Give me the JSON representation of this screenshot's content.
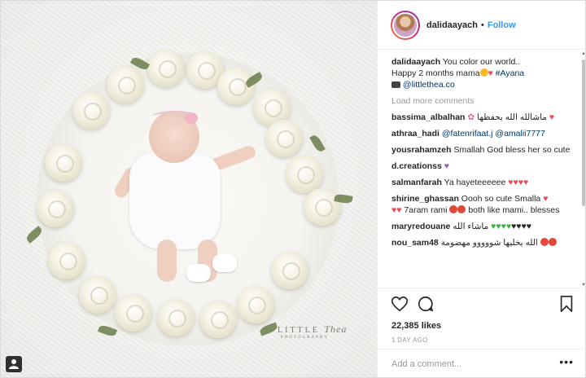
{
  "post": {
    "watermark": {
      "brand": "LITTLE",
      "brand_script": "Thea",
      "sub": "PHOTOGRAPHY"
    }
  },
  "header": {
    "username": "dalidaayach",
    "separator": "•",
    "follow_label": "Follow"
  },
  "caption": {
    "username": "dalidaayach",
    "line1": "You color our world..",
    "line2": "Happy 2 months mama",
    "hashtag": "#Ayana",
    "mention": "@littlethea.co"
  },
  "load_more": "Load more comments",
  "comments": [
    {
      "user": "bassima_albalhan",
      "text": "ماشالله الله يحفظها"
    },
    {
      "user": "athraa_hadi",
      "mention1": "@fatenrifaat.j",
      "mention2": "@amalii7777"
    },
    {
      "user": "yousrahamzeh",
      "text": "Smallah God bless her so cute"
    },
    {
      "user": "d.creationss"
    },
    {
      "user": "salmanfarah",
      "text": "Ya hayeteeeeee"
    },
    {
      "user": "shirine_ghassan",
      "text": "Oooh so cute Smalla",
      "text2": "7aram rami",
      "text3": "both like mami.. blesses"
    },
    {
      "user": "maryredouane",
      "text": "ماشاء الله"
    },
    {
      "user": "nou_sam48",
      "text": "الله يخليها شووووو مهضومة"
    }
  ],
  "actions": {
    "likes": "22,385 likes",
    "time": "1 DAY AGO",
    "comment_placeholder": "Add a comment...",
    "more_label": "•••"
  },
  "colors": {
    "link": "#003569",
    "follow": "#3897f0",
    "muted": "#999999",
    "heart": "#ed4956"
  },
  "icons": [
    "heart-outline-icon",
    "comment-bubble-icon",
    "bookmark-icon",
    "user-tag-icon",
    "more-options-icon"
  ]
}
